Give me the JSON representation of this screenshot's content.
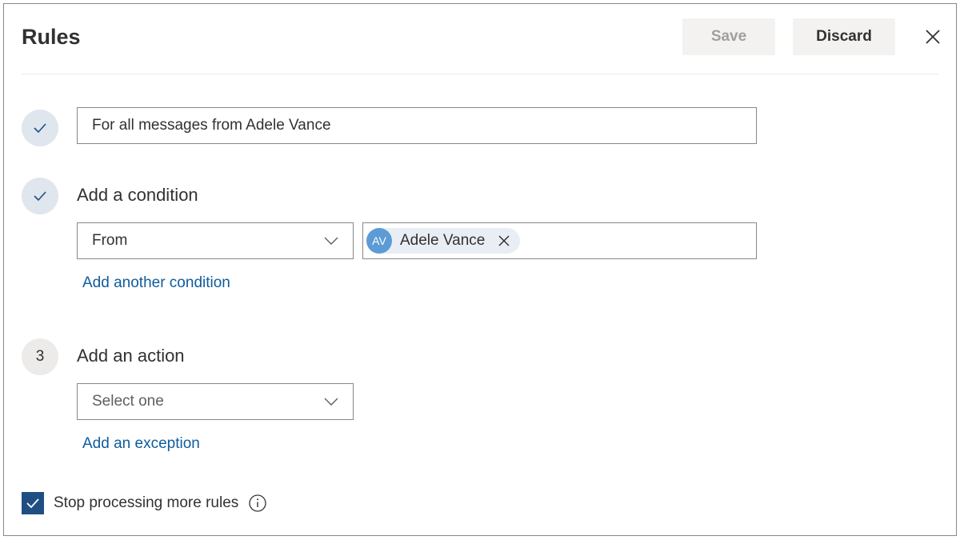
{
  "header": {
    "title": "Rules",
    "save_label": "Save",
    "discard_label": "Discard"
  },
  "steps": {
    "rule_name": {
      "value": "For all messages from Adele Vance"
    },
    "condition": {
      "label": "Add a condition",
      "dropdown_value": "From",
      "person": {
        "initials": "AV",
        "name": "Adele Vance"
      },
      "add_link": "Add another condition"
    },
    "action": {
      "number": "3",
      "label": "Add an action",
      "dropdown_placeholder": "Select one",
      "exception_link": "Add an exception"
    }
  },
  "options": {
    "stop_processing_label": "Stop processing more rules",
    "stop_processing_checked": true
  },
  "colors": {
    "accent": "#1f4f82",
    "link": "#0f5b9e",
    "avatar": "#5c9bd6",
    "step_done": "#dfe6ee"
  },
  "icons": {
    "step_done": "checkmark-icon",
    "close": "close-icon",
    "dropdown": "chevron-down-icon",
    "info": "info-icon"
  }
}
